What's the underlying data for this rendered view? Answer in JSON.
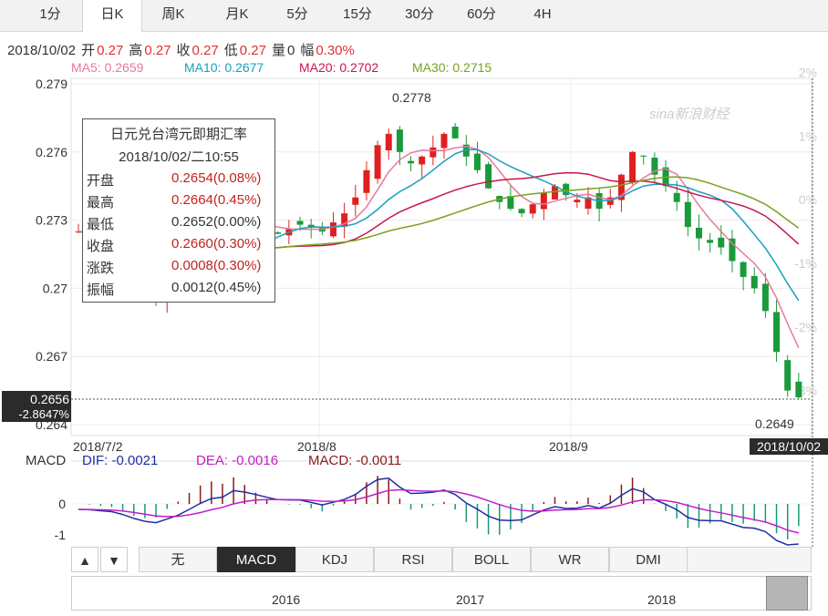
{
  "tabs": [
    {
      "label": "1分"
    },
    {
      "label": "日K"
    },
    {
      "label": "周K"
    },
    {
      "label": "月K"
    },
    {
      "label": "5分"
    },
    {
      "label": "15分"
    },
    {
      "label": "30分"
    },
    {
      "label": "60分"
    },
    {
      "label": "4H"
    }
  ],
  "info": {
    "date": "2018/10/02",
    "open_label": "开",
    "open": "0.27",
    "high_label": "高",
    "high": "0.27",
    "close_label": "收",
    "close": "0.27",
    "low_label": "低",
    "low": "0.27",
    "vol_label": "量",
    "vol": "0",
    "amp_label": "幅",
    "amp": "0.30%"
  },
  "ma": [
    {
      "label": "MA5: 0.2659",
      "color": "#e8789a"
    },
    {
      "label": "MA10: 0.2677",
      "color": "#1a9ec0"
    },
    {
      "label": "MA20: 0.2702",
      "color": "#c8174a"
    },
    {
      "label": "MA30: 0.2715",
      "color": "#7aa11e"
    }
  ],
  "watermark": "sina新浪财经",
  "tooltip": {
    "title": "日元兑台湾元即期汇率",
    "datetime": "2018/10/02/二10:55",
    "rows": [
      {
        "k": "开盘",
        "v": "0.2654(0.08%)",
        "red": true
      },
      {
        "k": "最高",
        "v": "0.2664(0.45%)",
        "red": true
      },
      {
        "k": "最低",
        "v": "0.2652(0.00%)",
        "red": false
      },
      {
        "k": "收盘",
        "v": "0.2660(0.30%)",
        "red": true
      },
      {
        "k": "涨跌",
        "v": "0.0008(0.30%)",
        "red": true
      },
      {
        "k": "振幅",
        "v": "0.0012(0.45%)",
        "red": false
      }
    ]
  },
  "price_badge": {
    "price": "0.2656",
    "pct": "-2.8647%"
  },
  "date_badge": "2018/10/02",
  "annotations": {
    "high": "0.2778",
    "low": "0.2649"
  },
  "macd_legend": {
    "title": "MACD",
    "dif": "DIF: -0.0021",
    "dea": "DEA: -0.0016",
    "macd": "MACD: -0.0011"
  },
  "indicator_buttons": [
    {
      "label": "无"
    },
    {
      "label": "MACD"
    },
    {
      "label": "KDJ"
    },
    {
      "label": "RSI"
    },
    {
      "label": "BOLL"
    },
    {
      "label": "WR"
    },
    {
      "label": "DMI"
    }
  ],
  "arrow_up": "▲",
  "arrow_down": "▼",
  "navigator": {
    "years": [
      "2016",
      "2017",
      "2018"
    ]
  },
  "chart_data": {
    "type": "candlestick",
    "y_ticks": [
      "0.279",
      "0.276",
      "0.273",
      "0.27",
      "0.267",
      "0.264"
    ],
    "pct_ticks": [
      "2%",
      "1%",
      "0%",
      "-1%",
      "-2%",
      "-3%"
    ],
    "x_ticks": [
      "2018/7/2",
      "2018/8",
      "2018/9"
    ],
    "ylim": [
      0.264,
      0.279
    ],
    "macd_ticks": [
      "0",
      "-1"
    ]
  }
}
